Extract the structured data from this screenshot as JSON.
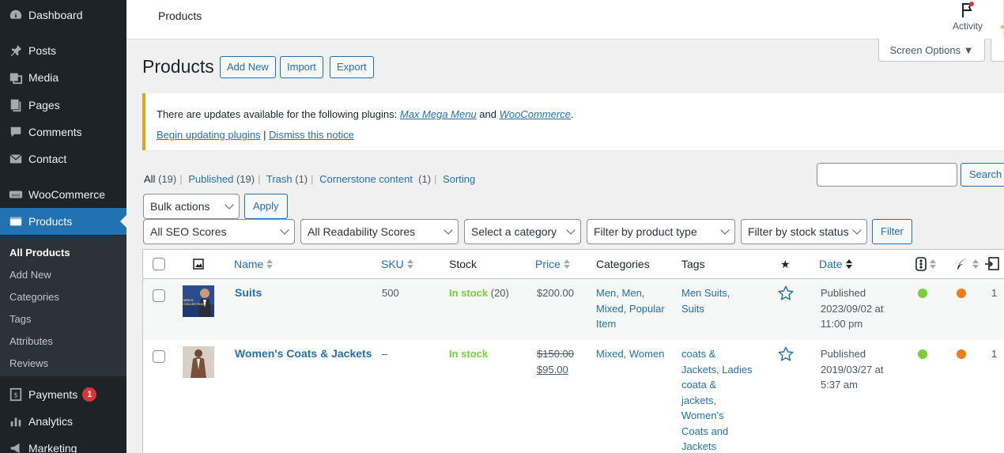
{
  "sidebar": {
    "items": [
      {
        "label": "Dashboard",
        "icon": "dashboard-icon"
      },
      {
        "label": "Posts",
        "icon": "pin-icon"
      },
      {
        "label": "Media",
        "icon": "media-icon"
      },
      {
        "label": "Pages",
        "icon": "pages-icon"
      },
      {
        "label": "Comments",
        "icon": "comments-icon"
      },
      {
        "label": "Contact",
        "icon": "mail-icon"
      },
      {
        "label": "WooCommerce",
        "icon": "woo-icon"
      },
      {
        "label": "Products",
        "icon": "products-icon"
      },
      {
        "label": "Payments",
        "icon": "payments-icon",
        "badge": "1"
      },
      {
        "label": "Analytics",
        "icon": "analytics-icon"
      },
      {
        "label": "Marketing",
        "icon": "marketing-icon"
      }
    ],
    "submenu": [
      "All Products",
      "Add New",
      "Categories",
      "Tags",
      "Attributes",
      "Reviews"
    ]
  },
  "topbar": {
    "title": "Products",
    "activity_label": "Activity"
  },
  "screen_options": "Screen Options ▼",
  "heading": {
    "title": "Products",
    "add_new": "Add New",
    "import": "Import",
    "export": "Export"
  },
  "notice": {
    "prefix": "There are updates available for the following plugins: ",
    "plugin1": "Max Mega Menu",
    "and": " and ",
    "plugin2": "WooCommerce",
    "suffix": ".",
    "begin": "Begin updating plugins",
    "sep": " | ",
    "dismiss": "Dismiss this notice"
  },
  "views": [
    {
      "label": "All",
      "count": "(19)"
    },
    {
      "label": "Published",
      "count": "(19)"
    },
    {
      "label": "Trash",
      "count": "(1)"
    },
    {
      "label": "Cornerstone content",
      "count": "(1)"
    },
    {
      "label": "Sorting",
      "count": ""
    }
  ],
  "search": {
    "button": "Search p"
  },
  "bulk": {
    "select": "Bulk actions",
    "apply": "Apply"
  },
  "filters": {
    "seo": "All SEO Scores",
    "readability": "All Readability Scores",
    "category": "Select a category",
    "product_type": "Filter by product type",
    "stock_status": "Filter by stock status",
    "filter_button": "Filter"
  },
  "columns": {
    "name": "Name",
    "sku": "SKU",
    "stock": "Stock",
    "price": "Price",
    "categories": "Categories",
    "tags": "Tags",
    "featured": "★",
    "date": "Date"
  },
  "products": [
    {
      "name": "Suits",
      "sku": "500",
      "stock": "In stock",
      "stock_qty": " (20)",
      "price": "$200.00",
      "categories": [
        "Men, Men,",
        "Mixed, Popular",
        "Item"
      ],
      "tags": [
        "Men Suits,",
        "Suits"
      ],
      "date": [
        "Published",
        "2023/09/02 at",
        "11:00 pm"
      ],
      "count": "1",
      "thumb_text": "MEN'S COLLECTION"
    },
    {
      "name": "Women's Coats & Jackets",
      "sku": "–",
      "stock": "In stock",
      "stock_qty": "",
      "price_regular": "$150.00",
      "price_sale": "$95.00",
      "categories": [
        "Mixed, Women"
      ],
      "tags": [
        "coats &",
        "Jackets, Ladies",
        "coata &",
        "jackets,",
        "Women's",
        "Coats and",
        "Jackets"
      ],
      "date": [
        "Published",
        "2019/03/27 at",
        "5:37 am"
      ],
      "count": "1"
    }
  ],
  "colors": {
    "sidebar": "#1d2327",
    "accent": "#2271b1",
    "in_stock": "#7ad03a",
    "seo_good": "#7ad03a",
    "readability_ok": "#ee7c1b",
    "notice_border": "#dba617"
  }
}
